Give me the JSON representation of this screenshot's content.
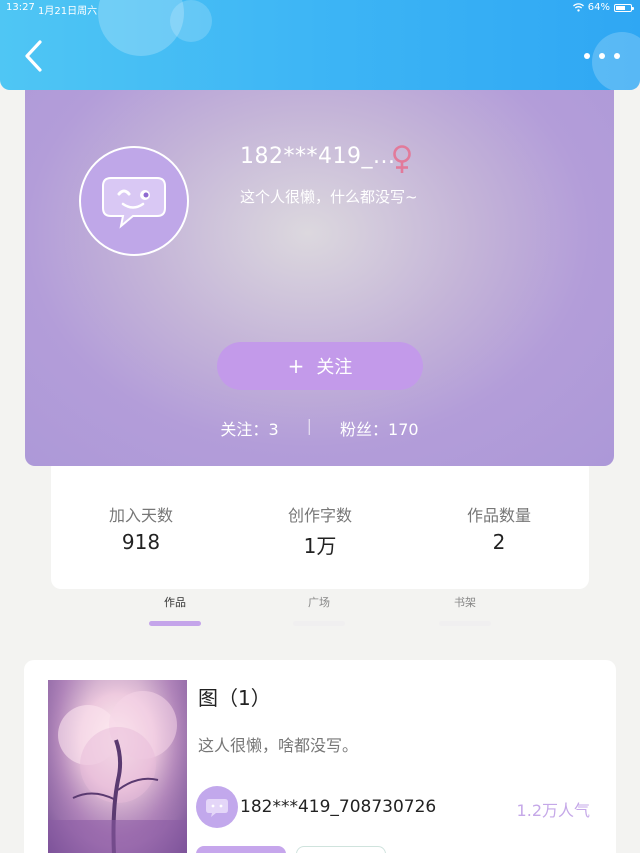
{
  "status_bar": {
    "time": "13:27",
    "date": "1月21日周六",
    "battery": "64%",
    "battery_level": 0.64
  },
  "nav": {
    "back_icon": "chevron-left-icon",
    "more_icon": "more-dots-icon"
  },
  "profile": {
    "username": "182***419_...",
    "bio": "这个人很懒，什么都没写~",
    "gender_icon": "female-icon",
    "follow_plus": "+",
    "follow_label": "关注",
    "following_label": "关注：",
    "following_value": "3",
    "separator": "|",
    "fans_label": "粉丝：",
    "fans_value": "170"
  },
  "stats": [
    {
      "label": "加入天数",
      "value": "918"
    },
    {
      "label": "创作字数",
      "value": "1万"
    },
    {
      "label": "作品数量",
      "value": "2"
    }
  ],
  "tabs": [
    {
      "label": "作品",
      "active": true
    },
    {
      "label": "广场",
      "active": false
    },
    {
      "label": "书架",
      "active": false
    }
  ],
  "work": {
    "title": "图（1）",
    "description": "这人很懒，啥都没写。",
    "author": "182***419_708730726",
    "popularity": "1.2万人气"
  },
  "colors": {
    "topbar": "#3db5f5",
    "profile_bg": "#b39dd9",
    "accent": "#c39aea",
    "female": "#e27a9a"
  }
}
